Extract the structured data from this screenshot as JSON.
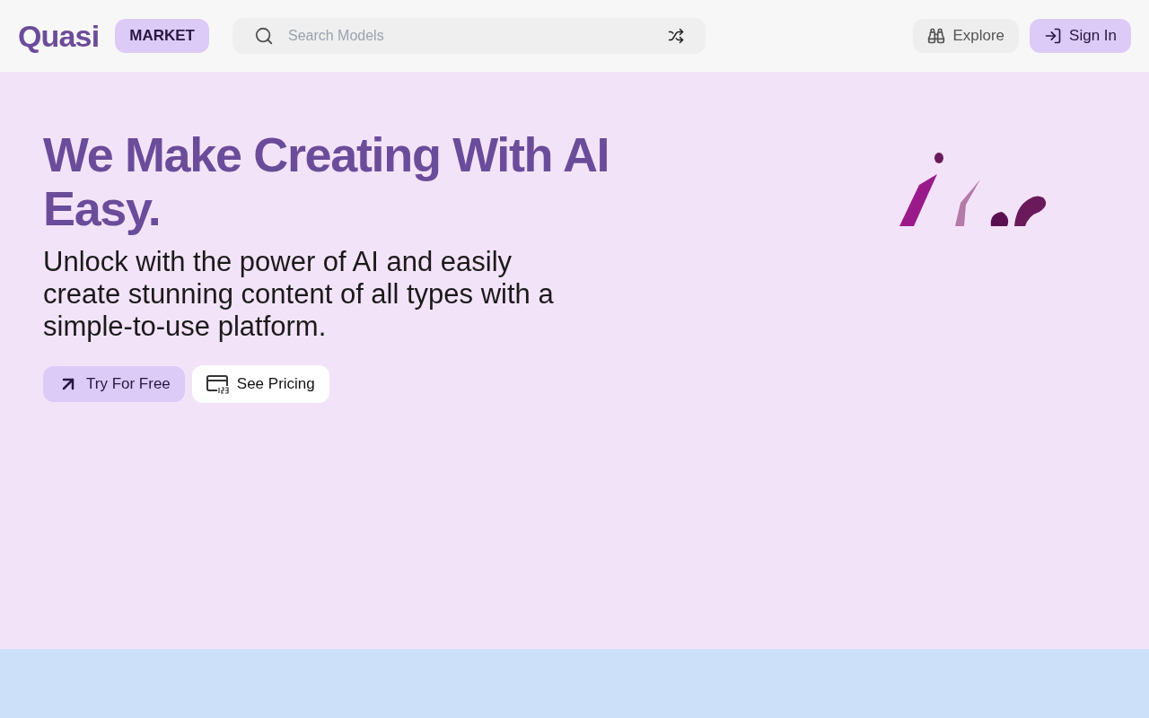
{
  "header": {
    "logo": "Quasi",
    "badge": "MARKET",
    "search": {
      "placeholder": "Search Models"
    },
    "buttons": [
      {
        "label": "Explore",
        "kind": "explore"
      },
      {
        "label": "Sign In",
        "kind": "signin"
      }
    ]
  },
  "hero": {
    "title": "We Make Creating With AI Easy.",
    "subtitle": "Unlock with the power of AI and easily create stunning content of all types with a simple-to-use platform.",
    "buttons": [
      {
        "label": "Try For Free",
        "kind": "try"
      },
      {
        "label": "See Pricing",
        "kind": "pricing"
      }
    ]
  }
}
